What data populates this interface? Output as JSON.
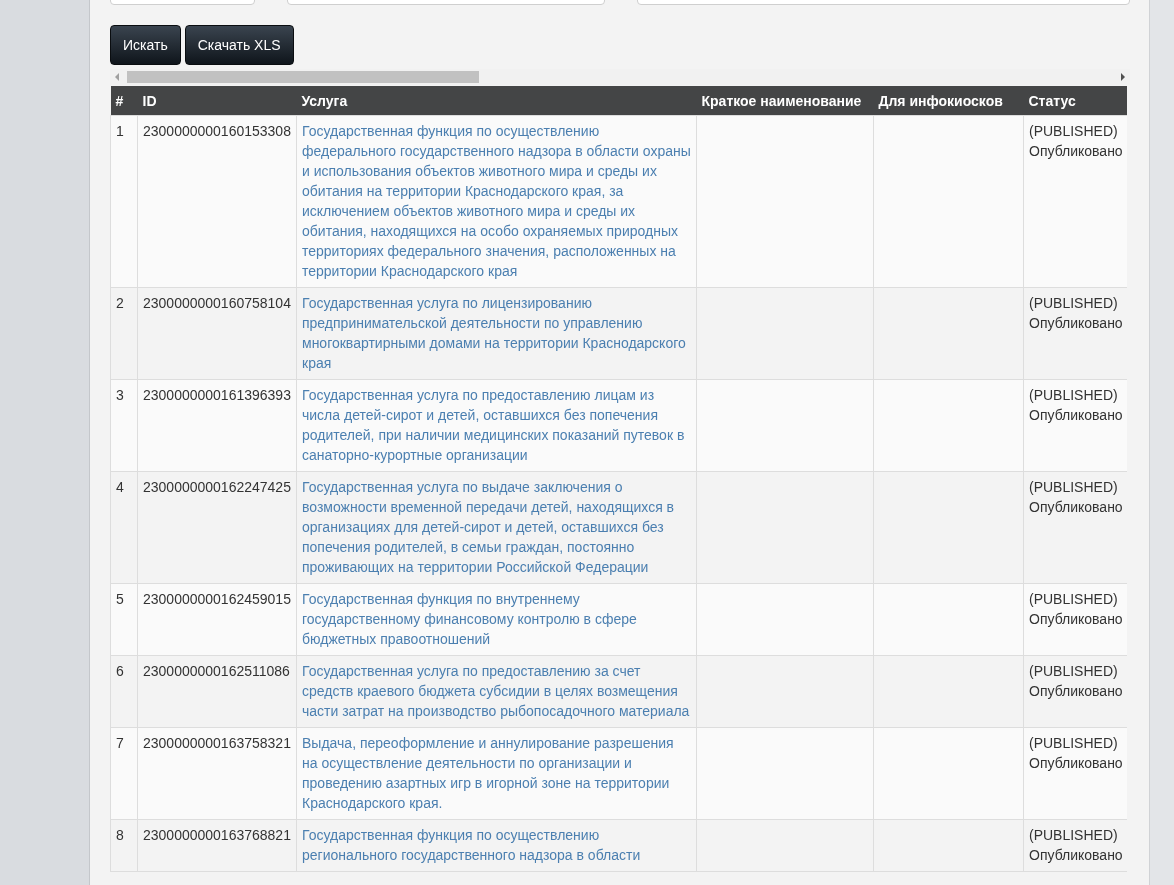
{
  "filters": [
    {
      "kind": "input"
    },
    {
      "kind": "input"
    },
    {
      "kind": "input"
    }
  ],
  "buttons": [
    "Искать",
    "Скачать XLS"
  ],
  "table": {
    "columns": [
      "#",
      "ID",
      "Услуга",
      "Краткое наименование",
      "Для инфокиосков",
      "Статус"
    ],
    "rows": [
      {
        "num": "1",
        "id": "2300000000160153308",
        "service": "Государственная функция по осуществлению федерального государственного надзора в области охраны и использования объектов животного мира и среды их обитания на территории Краснодарского края, за исключением объектов животного мира и среды их обитания, находящихся на особо охраняемых природных территориях федерального значения, расположенных на территории Краснодарского края",
        "status_code": "(PUBLISHED)",
        "status_label": "Опубликовано"
      },
      {
        "num": "2",
        "id": "2300000000160758104",
        "service": "Государственная услуга по лицензированию предпринимательской деятельности по управлению многоквартирными домами на территории Краснодарского края",
        "status_code": "(PUBLISHED)",
        "status_label": "Опубликовано"
      },
      {
        "num": "3",
        "id": "2300000000161396393",
        "service": "Государственная услуга по предоставлению лицам из числа детей-сирот и детей, оставшихся без попечения родителей, при наличии медицинских показаний путевок в санаторно-курортные организации",
        "status_code": "(PUBLISHED)",
        "status_label": "Опубликовано"
      },
      {
        "num": "4",
        "id": "2300000000162247425",
        "service": "Государственная услуга по выдаче заключения о возможности временной передачи детей, находящихся в организациях для детей-сирот и детей, оставшихся без попечения родителей, в семьи граждан, постоянно проживающих на территории Российской Федерации",
        "status_code": "(PUBLISHED)",
        "status_label": "Опубликовано"
      },
      {
        "num": "5",
        "id": "2300000000162459015",
        "service": "Государственная функция по внутреннему государственному финансовому контролю в сфере бюджетных правоотношений",
        "status_code": "(PUBLISHED)",
        "status_label": "Опубликовано"
      },
      {
        "num": "6",
        "id": "2300000000162511086",
        "service": "Государственная услуга по предоставлению за счет средств краевого бюджета субсидии в целях возмещения части затрат на производство рыбопосадочного материала",
        "status_code": "(PUBLISHED)",
        "status_label": "Опубликовано"
      },
      {
        "num": "7",
        "id": "2300000000163758321",
        "service": "Выдача, переоформление и аннулирование разрешения на осуществление деятельности по организации и проведению азартных игр в игорной зоне на территории Краснодарского края.",
        "status_code": "(PUBLISHED)",
        "status_label": "Опубликовано"
      },
      {
        "num": "8",
        "id": "2300000000163768821",
        "service": "Государственная функция по осуществлению регионального государственного надзора в области",
        "status_code": "(PUBLISHED)",
        "status_label": "Опубликовано"
      }
    ]
  }
}
